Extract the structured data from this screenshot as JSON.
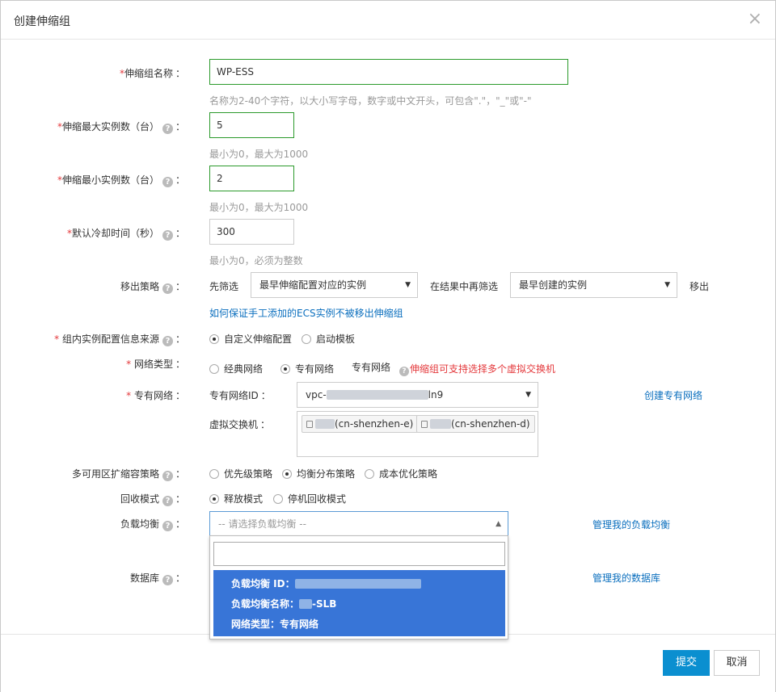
{
  "dialog": {
    "title": "创建伸缩组",
    "close_icon": "×"
  },
  "form": {
    "name": {
      "label": "伸缩组名称",
      "value": "WP-ESS",
      "hint": "名称为2-40个字符，以大小写字母，数字或中文开头，可包含\".\"，\"_\"或\"-\""
    },
    "max": {
      "label": "伸缩最大实例数（台）",
      "value": "5",
      "hint": "最小为0，最大为1000"
    },
    "min": {
      "label": "伸缩最小实例数（台）",
      "value": "2",
      "hint": "最小为0，最大为1000"
    },
    "cooldown": {
      "label": "默认冷却时间（秒）",
      "value": "300",
      "hint": "最小为0，必须为整数"
    },
    "removal": {
      "label": "移出策略",
      "first_filter_label": "先筛选",
      "first_filter_value": "最早伸缩配置对应的实例",
      "then_filter_label": "在结果中再筛选",
      "then_filter_value": "最早创建的实例",
      "suffix": "移出",
      "link": "如何保证手工添加的ECS实例不被移出伸缩组"
    },
    "config_source": {
      "label": "组内实例配置信息来源",
      "options": [
        "自定义伸缩配置",
        "启动模板"
      ],
      "selected": 0
    },
    "network_type": {
      "label": "网络类型",
      "options": [
        "经典网络",
        "专有网络"
      ],
      "selected": 1,
      "current": "专有网络",
      "note": "伸缩组可支持选择多个虚拟交换机"
    },
    "vpc": {
      "label": "专有网络",
      "vpc_id_label": "专有网络ID",
      "vpc_prefix": "vpc-",
      "vpc_suffix": "ln9",
      "create_link": "创建专有网络",
      "vswitch_label": "虚拟交换机",
      "vswitches": [
        "(cn-shenzhen-e)",
        "(cn-shenzhen-d)"
      ]
    },
    "multi_az": {
      "label": "多可用区扩缩容策略",
      "options": [
        "优先级策略",
        "均衡分布策略",
        "成本优化策略"
      ],
      "selected": 1
    },
    "recycle": {
      "label": "回收模式",
      "options": [
        "释放模式",
        "停机回收模式"
      ],
      "selected": 0
    },
    "slb": {
      "label": "负载均衡",
      "placeholder": "-- 请选择负载均衡 --",
      "manage_link": "管理我的负载均衡",
      "option_id_label": "负载均衡 ID：",
      "option_name_label": "负载均衡名称：",
      "option_name_suffix": "-SLB",
      "option_net_label": "网络类型：专有网络"
    },
    "db": {
      "label": "数据库",
      "manage_link": "管理我的数据库"
    }
  },
  "footer": {
    "submit": "提交",
    "cancel": "取消"
  },
  "colors": {
    "primary": "#0b8fd0",
    "link": "#0b6fbe",
    "required": "#e4393c",
    "valid_border": "#2b9a2b",
    "option_highlight": "#3875d7"
  },
  "icons": {
    "help": "question-circle-icon",
    "caret": "caret-down-icon",
    "vswitch": "vswitch-icon"
  }
}
